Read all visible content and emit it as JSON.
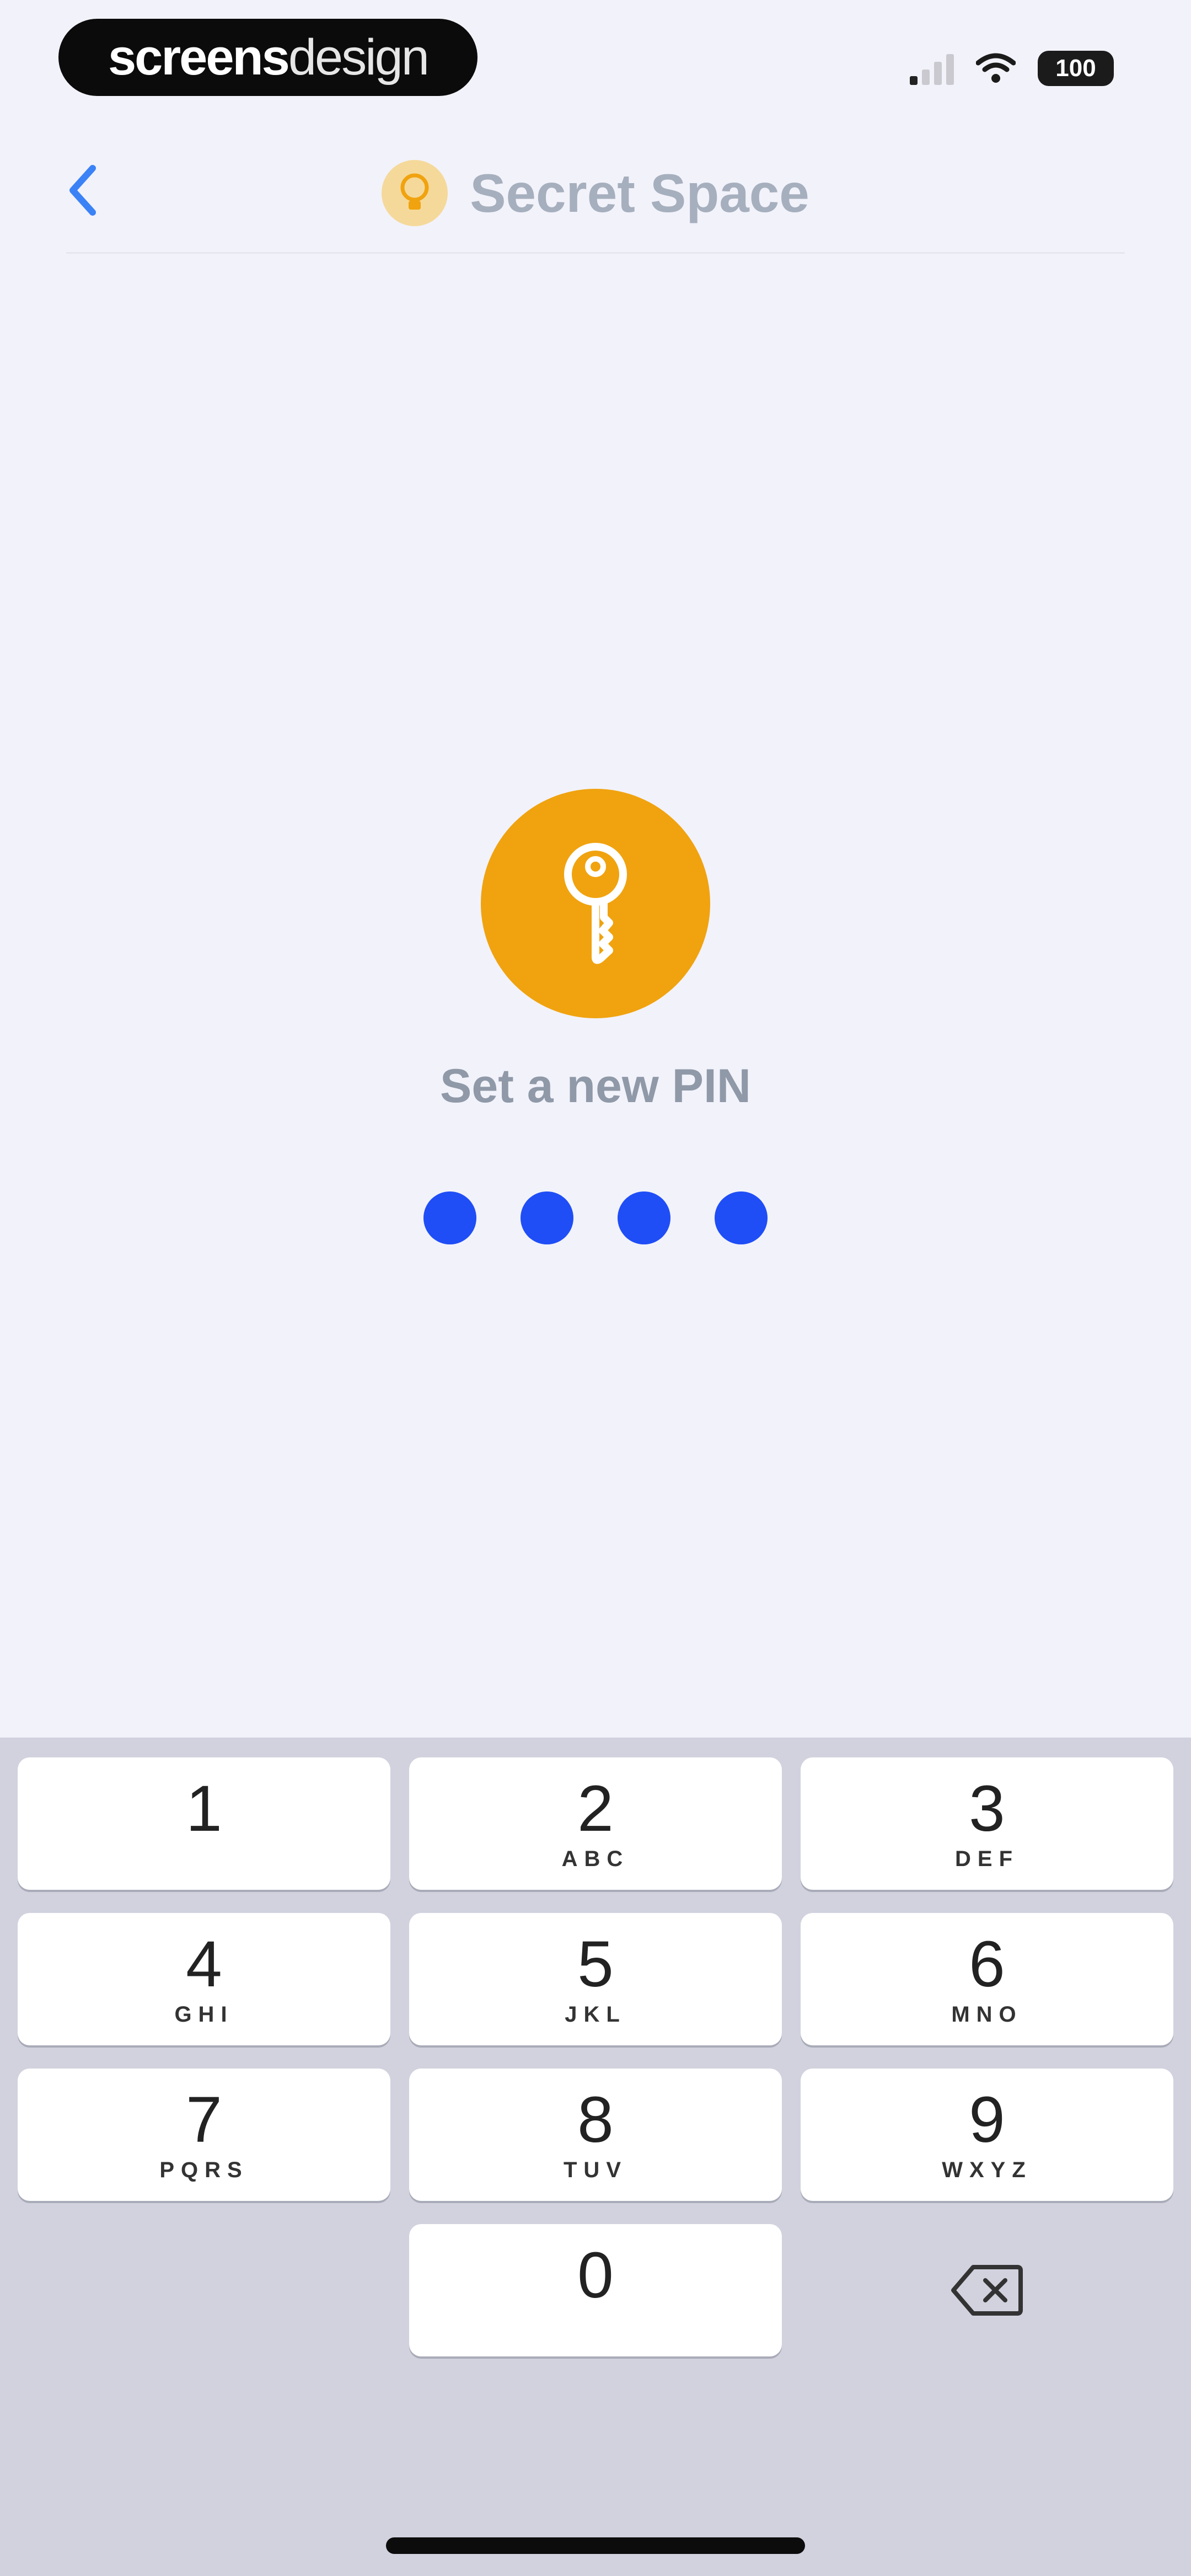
{
  "status_bar": {
    "watermark_bold": "screens",
    "watermark_light": "design",
    "battery": "100",
    "signal_icon": "cellular-signal-icon",
    "wifi_icon": "wifi-icon",
    "battery_icon": "battery-icon"
  },
  "nav": {
    "back_icon": "chevron-left-icon",
    "title": "Secret Space",
    "title_icon": "lightbulb-icon",
    "back_color": "#3b82f6"
  },
  "main": {
    "icon": "key-icon",
    "icon_color": "#f0a30f",
    "prompt": "Set a new PIN",
    "pin_filled": 4,
    "pin_length": 4,
    "dot_color": "#1f4ef6"
  },
  "keypad": {
    "keys": [
      {
        "digit": "1",
        "letters": ""
      },
      {
        "digit": "2",
        "letters": "ABC"
      },
      {
        "digit": "3",
        "letters": "DEF"
      },
      {
        "digit": "4",
        "letters": "GHI"
      },
      {
        "digit": "5",
        "letters": "JKL"
      },
      {
        "digit": "6",
        "letters": "MNO"
      },
      {
        "digit": "7",
        "letters": "PQRS"
      },
      {
        "digit": "8",
        "letters": "TUV"
      },
      {
        "digit": "9",
        "letters": "WXYZ"
      },
      {
        "digit": "0",
        "letters": ""
      }
    ],
    "delete_icon": "delete-backspace-icon"
  }
}
